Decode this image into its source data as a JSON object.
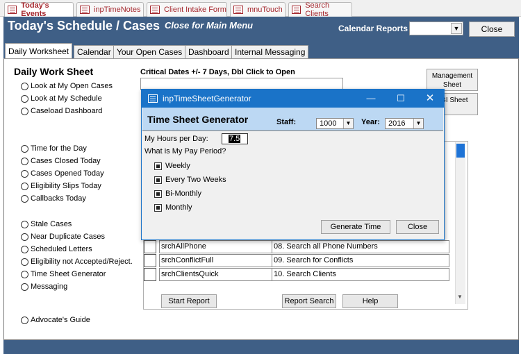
{
  "doc_tabs": [
    {
      "label": "Today's Events",
      "active": true
    },
    {
      "label": "inpTimeNotes",
      "active": false
    },
    {
      "label": "Client Intake Form",
      "active": false
    },
    {
      "label": "mnuTouch",
      "active": false
    },
    {
      "label": "Search Clients",
      "active": false
    }
  ],
  "header": {
    "title": "Today's Schedule / Cases",
    "subtitle_link": "Close for Main Menu",
    "calendar_reports_label": "Calendar Reports",
    "calendar_reports_value": "",
    "close_button": "Close"
  },
  "form_tabs": [
    {
      "label": "Daily Worksheet",
      "active": true
    },
    {
      "label": "Calendar",
      "active": false
    },
    {
      "label": "Your Open Cases",
      "active": false
    },
    {
      "label": "Dashboard",
      "active": false
    },
    {
      "label": "Internal Messaging",
      "active": false
    }
  ],
  "worksheet": {
    "title": "Daily Work Sheet",
    "options": [
      "Look at My Open Cases",
      "Look at My Schedule",
      "Caseload Dashboard",
      "Time for the Day",
      "Cases Closed Today",
      "Cases Opened Today",
      "Eligibility Slips Today",
      "Callbacks Today",
      "Stale Cases",
      "Near Duplicate Cases",
      "Scheduled Letters",
      "Eligibility not Accepted/Reject.",
      "Time Sheet Generator",
      "Messaging",
      "Advocate's Guide"
    ],
    "critical_dates_label": "Critical Dates +/- 7 Days, Dbl Click to Open",
    "side_buttons": [
      "Management Sheet",
      "PBI Sheet"
    ],
    "report_rows": [
      {
        "name": "srchAllPhone",
        "desc": "08. Search all Phone Numbers"
      },
      {
        "name": "srchConflictFull",
        "desc": "09. Search for Conflicts"
      },
      {
        "name": "srchClientsQuick",
        "desc": "10. Search Clients"
      }
    ],
    "buttons": {
      "start_report": "Start Report",
      "report_search": "Report Search",
      "help": "Help"
    }
  },
  "dialog": {
    "window_title": "inpTimeSheetGenerator",
    "heading": "Time Sheet Generator",
    "staff_label": "Staff:",
    "staff_value": "1000",
    "year_label": "Year:",
    "year_value": "2016",
    "hours_label": "My Hours per Day:",
    "hours_value": "7.5",
    "pay_period_label": "What is My Pay Period?",
    "pay_periods": [
      "Weekly",
      "Every Two Weeks",
      "Bi-Monthly",
      "Monthly"
    ],
    "generate_button": "Generate Time",
    "close_button": "Close"
  },
  "colors": {
    "header_bg": "#3f5f86",
    "dialog_title_bg": "#1a73c8",
    "dialog_head_bg": "#bcd8f3",
    "tab_text": "#a4262c"
  }
}
